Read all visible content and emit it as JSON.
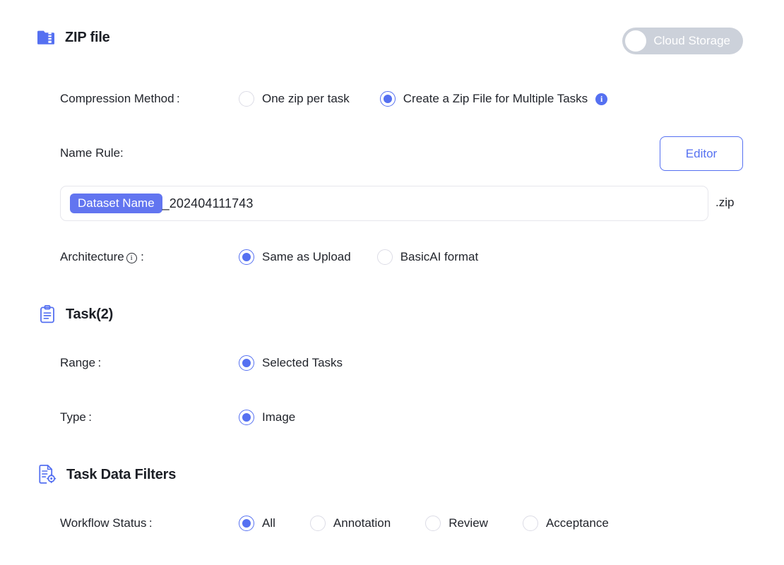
{
  "zip_section": {
    "icon": "zip-file-icon",
    "title": "ZIP file",
    "cloud_toggle": {
      "label": "Cloud Storage",
      "state": "off",
      "track_color": "#ccd1da"
    },
    "compression": {
      "label": "Compression Method :",
      "options": [
        {
          "label": "One zip per task",
          "selected": false
        },
        {
          "label": "Create a Zip File for Multiple Tasks",
          "selected": true,
          "info_icon": "info-filled-icon"
        }
      ]
    },
    "name_rule": {
      "label": "Name Rule:",
      "editor_button": "Editor",
      "token": "Dataset Name",
      "value": "_202404111743",
      "suffix": ".zip"
    },
    "architecture": {
      "label": "Architecture",
      "info_icon": "info-outline-icon",
      "colon": " :",
      "options": [
        {
          "label": "Same as Upload",
          "selected": true
        },
        {
          "label": "BasicAI format",
          "selected": false
        }
      ]
    }
  },
  "task_section": {
    "icon": "clipboard-icon",
    "title": "Task(2)",
    "range": {
      "label": "Range :",
      "options": [
        {
          "label": "Selected Tasks",
          "selected": true
        }
      ]
    },
    "type": {
      "label": "Type :",
      "options": [
        {
          "label": "Image",
          "selected": true
        }
      ]
    }
  },
  "filters_section": {
    "icon": "document-settings-icon",
    "title": "Task Data Filters",
    "workflow_status": {
      "label": "Workflow Status :",
      "options": [
        {
          "label": "All",
          "selected": true
        },
        {
          "label": "Annotation",
          "selected": false
        },
        {
          "label": "Review",
          "selected": false
        },
        {
          "label": "Acceptance",
          "selected": false
        }
      ]
    }
  },
  "colors": {
    "accent": "#5570f1",
    "token": "#6275f0",
    "toggle_off": "#ccd1da",
    "border": "#e6e6ec",
    "text": "#22252c"
  }
}
